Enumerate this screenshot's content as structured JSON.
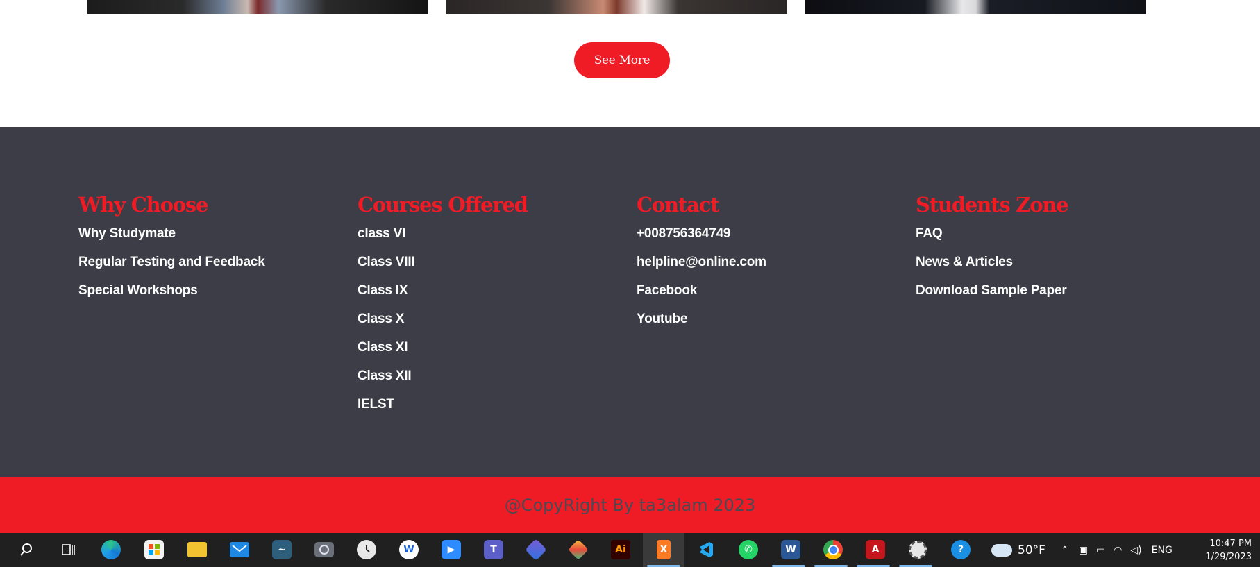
{
  "see_more_label": "See More",
  "footer": {
    "columns": [
      {
        "heading": "Why Choose",
        "links": [
          "Why Studymate",
          "Regular Testing and Feedback",
          "Special Workshops"
        ]
      },
      {
        "heading": "Courses Offered",
        "links": [
          "class VI",
          "Class VIII",
          "Class IX",
          "Class X",
          "Class XI",
          "Class XII",
          "IELST"
        ]
      },
      {
        "heading": "Contact",
        "links": [
          "+008756364749",
          "helpline@online.com",
          "Facebook",
          "Youtube"
        ]
      },
      {
        "heading": "Students Zone",
        "links": [
          "FAQ",
          "News & Articles",
          "Download Sample Paper"
        ]
      }
    ],
    "copyright": "@CopyRight By ta3alam 2023"
  },
  "colors": {
    "accent": "#ef1c25",
    "footer_bg": "#3d3d48",
    "taskbar_bg": "#202020"
  },
  "taskbar": {
    "apps": [
      "search-icon",
      "task-view-icon",
      "edge-icon",
      "store-icon",
      "file-explorer-icon",
      "mail-icon",
      "mysql-workbench-icon",
      "camera-icon",
      "clock-icon",
      "wps-icon",
      "zoom-icon",
      "teams-icon",
      "power-automate-icon",
      "git-icon",
      "illustrator-icon",
      "xampp-icon",
      "vscode-icon",
      "whatsapp-icon",
      "word-icon",
      "chrome-icon",
      "acrobat-icon",
      "settings-gear-icon",
      "help-icon"
    ],
    "weather": "50°F",
    "language": "ENG",
    "time": "10:47 PM",
    "date": "1/29/2023"
  }
}
